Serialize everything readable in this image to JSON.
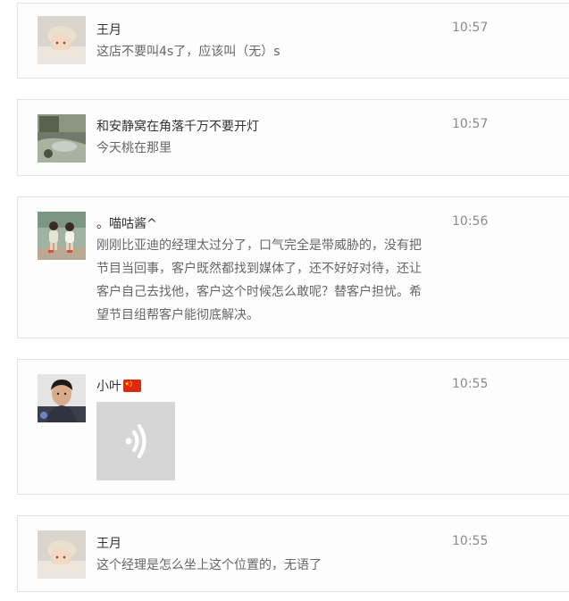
{
  "comments": [
    {
      "name": "王月",
      "time": "10:57",
      "text": "这店不要叫4s了，应该叫（无）s",
      "avatar_icon": "baby-photo-avatar"
    },
    {
      "name": "和安静窝在角落千万不要开灯",
      "time": "10:57",
      "text": "今天桃在那里",
      "avatar_icon": "outdoor-scene-avatar"
    },
    {
      "name": "。喵咕酱^",
      "time": "10:56",
      "text": "刚刚比亚迪的经理太过分了，口气完全是带威胁的，没有把节目当回事，客户既然都找到媒体了，还不好好对待，还让客户自己去找他，客户这个时候怎么敢呢？替客户担忧。希望节目组帮客户能彻底解决。",
      "lines": [
        "刚刚比亚迪的经理太过分了，口气完全是带威胁的，没有把",
        "节目当回事，客户既然都找到媒体了，还不好好对待，还让",
        "客户自己去找他，客户这个时候怎么敢呢？替客户担忧。希",
        "望节目组帮客户能彻底解决。"
      ],
      "avatar_icon": "two-children-avatar"
    },
    {
      "name": "小叶",
      "name_emoji": "china-flag-icon",
      "time": "10:55",
      "voice_icon": "voice-message-icon",
      "avatar_icon": "man-photo-avatar"
    },
    {
      "name": "王月",
      "time": "10:55",
      "text": "这个经理是怎么坐上这个位置的，无语了",
      "avatar_icon": "baby-photo-avatar"
    }
  ],
  "colors": {
    "name": "#333333",
    "text": "#666666",
    "time": "#8a8a8a",
    "border": "#e3e3e3",
    "voice_bg": "#d6d6d6",
    "flag_red": "#de2910",
    "flag_star": "#ffde00"
  }
}
